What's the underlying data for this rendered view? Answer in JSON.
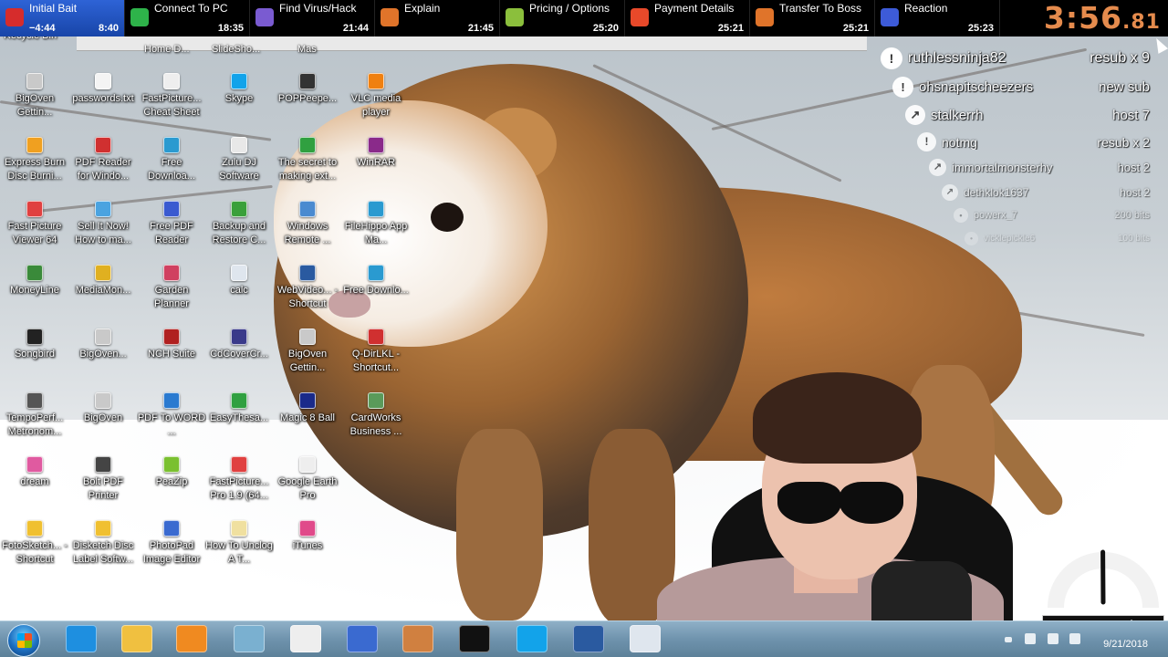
{
  "splits": [
    {
      "name": "Initial Bait",
      "delta": "−4:44",
      "time": "8:40",
      "active": true,
      "icon": "siren-icon",
      "color": "#d62c2c"
    },
    {
      "name": "Connect To PC",
      "delta": "",
      "time": "18:35",
      "active": false,
      "icon": "shield-icon",
      "color": "#2eb34a"
    },
    {
      "name": "Find Virus/Hack",
      "delta": "",
      "time": "21:44",
      "active": false,
      "icon": "bug-icon",
      "color": "#7a5bd1"
    },
    {
      "name": "Explain",
      "delta": "",
      "time": "21:45",
      "active": false,
      "icon": "chart-icon",
      "color": "#e0742a"
    },
    {
      "name": "Pricing / Options",
      "delta": "",
      "time": "25:20",
      "active": false,
      "icon": "money-icon",
      "color": "#8bbf3c"
    },
    {
      "name": "Payment Details",
      "delta": "",
      "time": "25:21",
      "active": false,
      "icon": "fire-icon",
      "color": "#e8492a"
    },
    {
      "name": "Transfer To Boss",
      "delta": "",
      "time": "25:21",
      "active": false,
      "icon": "chart-icon",
      "color": "#e0742a"
    },
    {
      "name": "Reaction",
      "delta": "",
      "time": "25:23",
      "active": false,
      "icon": "face-icon",
      "color": "#3d5bd8"
    }
  ],
  "timer": {
    "main": "3:56",
    "centis": ".81",
    "color": "#e58b4d"
  },
  "alerts": [
    {
      "user": "ruthlessninja82",
      "type": "resub x 9",
      "icon": "!"
    },
    {
      "user": "ohsnapitscheezers",
      "type": "new sub",
      "icon": "!"
    },
    {
      "user": "stalkerrh",
      "type": "host 7",
      "icon": "↗"
    },
    {
      "user": "notmg",
      "type": "resub x 2",
      "icon": "!"
    },
    {
      "user": "immortalmonsterhy",
      "type": "host 2",
      "icon": "↗"
    },
    {
      "user": "dethklok1637",
      "type": "host 2",
      "icon": "↗"
    },
    {
      "user": "powerx_7",
      "type": "200 bits",
      "icon": "•"
    },
    {
      "user": "vicklepickle6",
      "type": "100 bits",
      "icon": "•"
    }
  ],
  "desktop": {
    "partial_top": [
      "Recycle Bin",
      "Home D...",
      "SlideSho...",
      "Mas"
    ],
    "icons": [
      {
        "label": "BigOven Gettin...",
        "color": "#c9c9c9"
      },
      {
        "label": "Express Burn Disc Burni...",
        "color": "#f0a020"
      },
      {
        "label": "Fast Picture Viewer 64",
        "color": "#e04040"
      },
      {
        "label": "MoneyLine",
        "color": "#3a8a3a"
      },
      {
        "label": "Songbird",
        "color": "#222222"
      },
      {
        "label": "TempoPerf... Metronom...",
        "color": "#555555"
      },
      {
        "label": "dream",
        "color": "#e05aa0"
      },
      {
        "label": "FotoSketch... - Shortcut",
        "color": "#f0c030"
      },
      {
        "label": "passwords.txt",
        "color": "#f4f4f4"
      },
      {
        "label": "PDF Reader for Windo...",
        "color": "#d03030"
      },
      {
        "label": "Sell It Now! How to ma...",
        "color": "#4aa3e0"
      },
      {
        "label": "MediaMon...",
        "color": "#e0b020"
      },
      {
        "label": "BigOven...",
        "color": "#c9c9c9"
      },
      {
        "label": "BigOven",
        "color": "#c9c9c9"
      },
      {
        "label": "Bolt PDF Printer",
        "color": "#444444"
      },
      {
        "label": "Disketch Disc Label Softw...",
        "color": "#f0c030"
      },
      {
        "label": "FastPicture... Cheat Sheet",
        "color": "#eeeeee"
      },
      {
        "label": "Free Downloa...",
        "color": "#2a9ad0"
      },
      {
        "label": "Free PDF Reader",
        "color": "#3a5ad0"
      },
      {
        "label": "Garden Planner",
        "color": "#d04060"
      },
      {
        "label": "NCH Suite",
        "color": "#b02020"
      },
      {
        "label": "PDF To WORD ...",
        "color": "#2a7ad0"
      },
      {
        "label": "PeaZip",
        "color": "#7ac030"
      },
      {
        "label": "PhotoPad Image Editor",
        "color": "#3a6ad0"
      },
      {
        "label": "Skype",
        "color": "#12a3ea"
      },
      {
        "label": "Zulu DJ Software",
        "color": "#e8e8e8"
      },
      {
        "label": "Backup and Restore C...",
        "color": "#3aa03a"
      },
      {
        "label": "calc",
        "color": "#dfe6ee"
      },
      {
        "label": "CdCoverCr...",
        "color": "#3a3a8a"
      },
      {
        "label": "EasyThesa...",
        "color": "#30a040"
      },
      {
        "label": "FastPicture... Pro 1.9 (64...",
        "color": "#e04040"
      },
      {
        "label": "How To Unclog A T...",
        "color": "#f0e0a0"
      },
      {
        "label": "POPPeepe...",
        "color": "#333333"
      },
      {
        "label": "The secret to making ext...",
        "color": "#30a040"
      },
      {
        "label": "Windows Remote ...",
        "color": "#4a8ad0"
      },
      {
        "label": "WebVideo... - Shortcut",
        "color": "#2a5aa0"
      },
      {
        "label": "BigOven Gettin...",
        "color": "#c9c9c9"
      },
      {
        "label": "Magic 8 Ball",
        "color": "#1a2a8a"
      },
      {
        "label": "Google Earth Pro",
        "color": "#eeeeee"
      },
      {
        "label": "iTunes",
        "color": "#e04a8a"
      },
      {
        "label": "VLC media player",
        "color": "#f08010"
      },
      {
        "label": "WinRAR",
        "color": "#8a2a8a"
      },
      {
        "label": "FileHippo App Ma...",
        "color": "#2a9ad0"
      },
      {
        "label": "Free Downlo...",
        "color": "#2a9ad0"
      },
      {
        "label": "Q-DirLKL - Shortcut...",
        "color": "#d03030"
      },
      {
        "label": "CardWorks Business ...",
        "color": "#5a9a5a"
      }
    ]
  },
  "memometer": {
    "label": "memometer",
    "level": 0.52
  },
  "taskbar": {
    "apps": [
      "internet-explorer-icon",
      "file-explorer-icon",
      "media-player-icon",
      "notepad-icon",
      "solitaire-icon",
      "search-app-icon",
      "chess-icon",
      "dell-icon",
      "skype-icon",
      "globe-icon",
      "calculator-icon"
    ],
    "app_colors": [
      "#1e8fe0",
      "#f0c040",
      "#f08a20",
      "#7ab0d0",
      "#eeeeee",
      "#3a6ad0",
      "#d08040",
      "#111111",
      "#12a3ea",
      "#2a5aa0",
      "#dfe6ee"
    ],
    "date": "9/21/2018"
  }
}
